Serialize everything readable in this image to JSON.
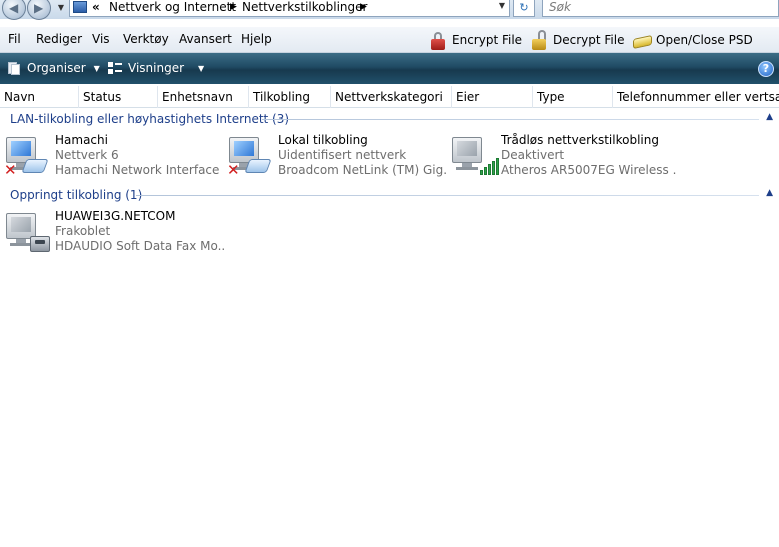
{
  "address": {
    "overflow": "«",
    "crumbs": [
      "Nettverk og Internett",
      "Nettverkstilkoblinger"
    ],
    "search_placeholder": "Søk"
  },
  "menu": {
    "items": [
      "Fil",
      "Rediger",
      "Vis",
      "Verktøy",
      "Avansert",
      "Hjelp"
    ],
    "tools": [
      "Encrypt File",
      "Decrypt File",
      "Open/Close PSD"
    ]
  },
  "commandbar": {
    "organize": "Organiser",
    "views": "Visninger",
    "help": "?"
  },
  "columns": [
    "Navn",
    "Status",
    "Enhetsnavn",
    "Tilkobling",
    "Nettverkskategori",
    "Eier",
    "Type",
    "Telefonnummer eller vertsa..."
  ],
  "groups": [
    {
      "label": "LAN-tilkobling eller høyhastighets Internett (3)",
      "items": [
        {
          "name": "Hamachi",
          "status": "Nettverk  6",
          "device": "Hamachi Network Interface",
          "icon": "network-disconnected-icon"
        },
        {
          "name": "Lokal tilkobling",
          "status": "Uidentifisert nettverk",
          "device": "Broadcom NetLink (TM) Gig...",
          "icon": "network-disconnected-icon"
        },
        {
          "name": "Trådløs nettverkstilkobling",
          "status": "Deaktivert",
          "device": "Atheros AR5007EG Wireless ...",
          "icon": "wireless-signal-icon"
        }
      ]
    },
    {
      "label": "Oppringt tilkobling (1)",
      "items": [
        {
          "name": "HUAWEI3G.NETCOM",
          "status": "Frakoblet",
          "device": "HDAUDIO Soft Data Fax Mo...",
          "icon": "dialup-modem-icon"
        }
      ]
    }
  ],
  "colors": {
    "commandbar": "#1f4a63",
    "group_header": "#1e3f8a",
    "secondary_text": "#6d6d6d"
  }
}
